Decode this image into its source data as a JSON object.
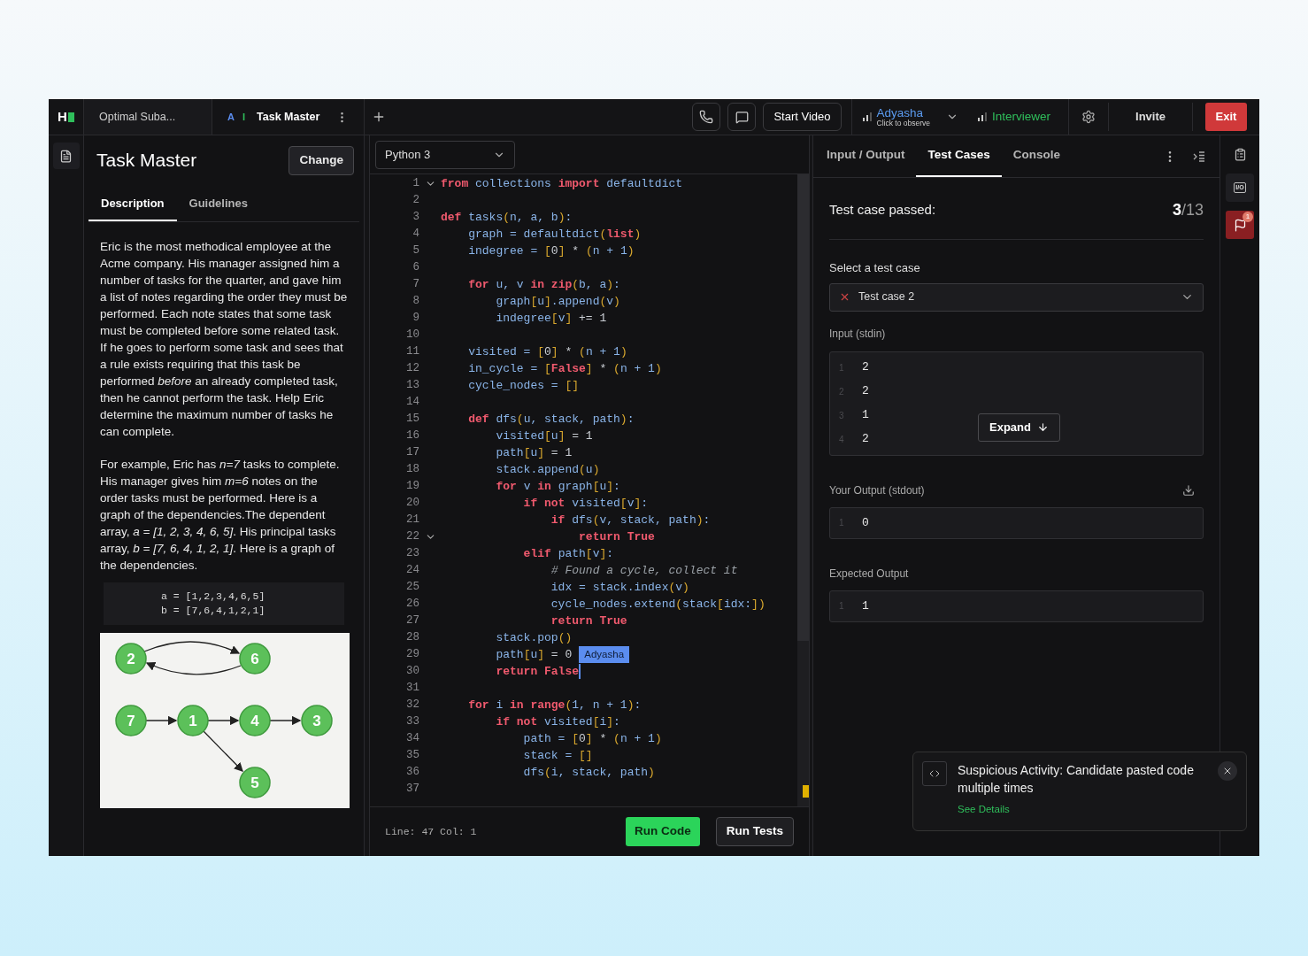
{
  "topbar": {
    "logo": "H",
    "tabs": [
      {
        "label": "Optimal Suba...",
        "selected": false
      },
      {
        "label": "Task Master",
        "selected": true,
        "markers": [
          {
            "text": "A",
            "color": "#5b8def"
          },
          {
            "text": "I",
            "color": "#2fbf5b"
          }
        ]
      }
    ],
    "start_video": "Start Video",
    "participants": [
      {
        "name": "Adyasha",
        "subtitle": "Click to observe",
        "color": "#5b9bf0",
        "menu": true
      },
      {
        "name": "Interviewer",
        "color": "#2fbf5b",
        "menu": false
      }
    ],
    "invite": "Invite",
    "exit": "Exit"
  },
  "problem": {
    "title": "Task Master",
    "change": "Change",
    "tabs": [
      {
        "label": "Description",
        "selected": true
      },
      {
        "label": "Guidelines",
        "selected": false
      }
    ],
    "paragraphs": [
      "Eric is the most methodical employee at the Acme company. His manager assigned him a number of tasks for the quarter, and gave him a list of notes regarding the order they must be performed. Each note states that some task must be completed before some related task. If he goes to perform some task and sees that a rule exists requiring that this task be performed *before* an already completed task, then he cannot perform the task. Help Eric determine the maximum number of tasks he can complete.",
      "For example, Eric has *n=7* tasks to complete. His manager gives him *m=6* notes on the order tasks must be performed. Here is a graph of the dependencies.The dependent array, *a = [1, 2, 3, 4, 6, 5]*. His principal tasks array, *b = [7, 6, 4, 1, 2, 1]*. Here is a graph of the dependencies."
    ],
    "code_sample": [
      "a = [1,2,3,4,6,5]",
      "b = [7,6,4,1,2,1]"
    ],
    "graph_nodes": [
      {
        "label": "2"
      },
      {
        "label": "6"
      },
      {
        "label": "7"
      },
      {
        "label": "1"
      },
      {
        "label": "4"
      },
      {
        "label": "3"
      },
      {
        "label": "5"
      }
    ]
  },
  "editor": {
    "language": "Python 3",
    "lines": [
      {
        "n": "1",
        "fold": true,
        "caret": false,
        "tokens": [
          {
            "kind": "kw",
            "text": "from"
          },
          {
            "kind": "name",
            "text": " collections "
          },
          {
            "kind": "kw",
            "text": "import"
          },
          {
            "kind": "name",
            "text": " defaultdict"
          }
        ]
      },
      {
        "n": "2",
        "fold": false,
        "caret": false
      },
      {
        "n": "3",
        "fold": false,
        "caret": false,
        "tokens": [
          {
            "kind": "kw",
            "text": "def"
          },
          {
            "kind": "name",
            "text": " tasks"
          },
          {
            "kind": "punct",
            "text": "("
          },
          {
            "kind": "name",
            "text": "n, a, b"
          },
          {
            "kind": "punct",
            "text": ")"
          },
          {
            "kind": "name",
            "text": ":"
          }
        ]
      },
      {
        "n": "4",
        "fold": false,
        "caret": false,
        "tokens": [
          {
            "kind": "name",
            "text": "    graph = defaultdict"
          },
          {
            "kind": "punct",
            "text": "("
          },
          {
            "kind": "kw",
            "text": "list"
          },
          {
            "kind": "punct",
            "text": ")"
          }
        ]
      },
      {
        "n": "5",
        "fold": false,
        "caret": false,
        "tokens": [
          {
            "kind": "name",
            "text": "    indegree = "
          },
          {
            "kind": "punct",
            "text": "["
          },
          {
            "kind": "op",
            "text": "0"
          },
          {
            "kind": "punct",
            "text": "]"
          },
          {
            "kind": "op",
            "text": " * "
          },
          {
            "kind": "punct",
            "text": "("
          },
          {
            "kind": "name",
            "text": "n + 1"
          },
          {
            "kind": "punct",
            "text": ")"
          }
        ]
      },
      {
        "n": "6",
        "fold": false,
        "caret": false
      },
      {
        "n": "7",
        "fold": false,
        "caret": false,
        "tokens": [
          {
            "kind": "kw",
            "text": "    for"
          },
          {
            "kind": "name",
            "text": " u, v "
          },
          {
            "kind": "kw",
            "text": "in zip"
          },
          {
            "kind": "punct",
            "text": "("
          },
          {
            "kind": "name",
            "text": "b, a"
          },
          {
            "kind": "punct",
            "text": ")"
          },
          {
            "kind": "name",
            "text": ":"
          }
        ]
      },
      {
        "n": "8",
        "fold": false,
        "caret": false,
        "tokens": [
          {
            "kind": "name",
            "text": "        graph"
          },
          {
            "kind": "punct",
            "text": "["
          },
          {
            "kind": "name",
            "text": "u"
          },
          {
            "kind": "punct",
            "text": "]"
          },
          {
            "kind": "name",
            "text": ".append"
          },
          {
            "kind": "punct",
            "text": "("
          },
          {
            "kind": "name",
            "text": "v"
          },
          {
            "kind": "punct",
            "text": ")"
          }
        ]
      },
      {
        "n": "9",
        "fold": false,
        "caret": false,
        "tokens": [
          {
            "kind": "name",
            "text": "        indegree"
          },
          {
            "kind": "punct",
            "text": "["
          },
          {
            "kind": "name",
            "text": "v"
          },
          {
            "kind": "punct",
            "text": "]"
          },
          {
            "kind": "op",
            "text": " += 1"
          }
        ]
      },
      {
        "n": "10",
        "fold": false,
        "caret": false
      },
      {
        "n": "11",
        "fold": false,
        "caret": false,
        "tokens": [
          {
            "kind": "name",
            "text": "    visited = "
          },
          {
            "kind": "punct",
            "text": "["
          },
          {
            "kind": "op",
            "text": "0"
          },
          {
            "kind": "punct",
            "text": "]"
          },
          {
            "kind": "op",
            "text": " * "
          },
          {
            "kind": "punct",
            "text": "("
          },
          {
            "kind": "name",
            "text": "n + 1"
          },
          {
            "kind": "punct",
            "text": ")"
          }
        ]
      },
      {
        "n": "12",
        "fold": false,
        "caret": false,
        "tokens": [
          {
            "kind": "name",
            "text": "    in_cycle = "
          },
          {
            "kind": "punct",
            "text": "["
          },
          {
            "kind": "kw",
            "text": "False"
          },
          {
            "kind": "punct",
            "text": "]"
          },
          {
            "kind": "op",
            "text": " * "
          },
          {
            "kind": "punct",
            "text": "("
          },
          {
            "kind": "name",
            "text": "n + 1"
          },
          {
            "kind": "punct",
            "text": ")"
          }
        ]
      },
      {
        "n": "13",
        "fold": false,
        "caret": false,
        "tokens": [
          {
            "kind": "name",
            "text": "    cycle_nodes = "
          },
          {
            "kind": "punct",
            "text": "[]"
          }
        ]
      },
      {
        "n": "14",
        "fold": false,
        "caret": false
      },
      {
        "n": "15",
        "fold": false,
        "caret": false,
        "tokens": [
          {
            "kind": "kw",
            "text": "    def"
          },
          {
            "kind": "name",
            "text": " dfs"
          },
          {
            "kind": "punct",
            "text": "("
          },
          {
            "kind": "name",
            "text": "u, stack, path"
          },
          {
            "kind": "punct",
            "text": ")"
          },
          {
            "kind": "name",
            "text": ":"
          }
        ]
      },
      {
        "n": "16",
        "fold": false,
        "caret": false,
        "tokens": [
          {
            "kind": "name",
            "text": "        visited"
          },
          {
            "kind": "punct",
            "text": "["
          },
          {
            "kind": "name",
            "text": "u"
          },
          {
            "kind": "punct",
            "text": "]"
          },
          {
            "kind": "op",
            "text": " = 1"
          }
        ]
      },
      {
        "n": "17",
        "fold": false,
        "caret": false,
        "tokens": [
          {
            "kind": "name",
            "text": "        path"
          },
          {
            "kind": "punct",
            "text": "["
          },
          {
            "kind": "name",
            "text": "u"
          },
          {
            "kind": "punct",
            "text": "]"
          },
          {
            "kind": "op",
            "text": " = 1"
          }
        ]
      },
      {
        "n": "18",
        "fold": false,
        "caret": false,
        "tokens": [
          {
            "kind": "name",
            "text": "        stack.append"
          },
          {
            "kind": "punct",
            "text": "("
          },
          {
            "kind": "name",
            "text": "u"
          },
          {
            "kind": "punct",
            "text": ")"
          }
        ]
      },
      {
        "n": "19",
        "fold": false,
        "caret": false,
        "tokens": [
          {
            "kind": "kw",
            "text": "        for"
          },
          {
            "kind": "name",
            "text": " v "
          },
          {
            "kind": "kw",
            "text": "in"
          },
          {
            "kind": "name",
            "text": " graph"
          },
          {
            "kind": "punct",
            "text": "["
          },
          {
            "kind": "name",
            "text": "u"
          },
          {
            "kind": "punct",
            "text": "]"
          },
          {
            "kind": "name",
            "text": ":"
          }
        ]
      },
      {
        "n": "20",
        "fold": false,
        "caret": false,
        "tokens": [
          {
            "kind": "kw",
            "text": "            if not"
          },
          {
            "kind": "name",
            "text": " visited"
          },
          {
            "kind": "punct",
            "text": "["
          },
          {
            "kind": "name",
            "text": "v"
          },
          {
            "kind": "punct",
            "text": "]"
          },
          {
            "kind": "name",
            "text": ":"
          }
        ]
      },
      {
        "n": "21",
        "fold": false,
        "caret": false,
        "tokens": [
          {
            "kind": "kw",
            "text": "                if"
          },
          {
            "kind": "name",
            "text": " dfs"
          },
          {
            "kind": "punct",
            "text": "("
          },
          {
            "kind": "name",
            "text": "v, stack, path"
          },
          {
            "kind": "punct",
            "text": ")"
          },
          {
            "kind": "name",
            "text": ":"
          }
        ]
      },
      {
        "n": "22",
        "fold": true,
        "caret": false,
        "tokens": [
          {
            "kind": "kw",
            "text": "                    return True"
          }
        ]
      },
      {
        "n": "23",
        "fold": false,
        "caret": false,
        "tokens": [
          {
            "kind": "kw",
            "text": "            elif"
          },
          {
            "kind": "name",
            "text": " path"
          },
          {
            "kind": "punct",
            "text": "["
          },
          {
            "kind": "name",
            "text": "v"
          },
          {
            "kind": "punct",
            "text": "]"
          },
          {
            "kind": "name",
            "text": ":"
          }
        ]
      },
      {
        "n": "24",
        "fold": false,
        "caret": false,
        "tokens": [
          {
            "kind": "comment",
            "text": "                # Found a cycle, collect it"
          }
        ]
      },
      {
        "n": "25",
        "fold": false,
        "caret": false,
        "tokens": [
          {
            "kind": "name",
            "text": "                idx = stack.index"
          },
          {
            "kind": "punct",
            "text": "("
          },
          {
            "kind": "name",
            "text": "v"
          },
          {
            "kind": "punct",
            "text": ")"
          }
        ]
      },
      {
        "n": "26",
        "fold": false,
        "caret": false,
        "tokens": [
          {
            "kind": "name",
            "text": "                cycle_nodes.extend"
          },
          {
            "kind": "punct",
            "text": "("
          },
          {
            "kind": "name",
            "text": "stack"
          },
          {
            "kind": "punct",
            "text": "["
          },
          {
            "kind": "name",
            "text": "idx:"
          },
          {
            "kind": "punct",
            "text": "])"
          }
        ]
      },
      {
        "n": "27",
        "fold": false,
        "caret": false,
        "tokens": [
          {
            "kind": "kw",
            "text": "                return True"
          }
        ]
      },
      {
        "n": "28",
        "fold": false,
        "caret": false,
        "tokens": [
          {
            "kind": "name",
            "text": "        stack.pop"
          },
          {
            "kind": "punct",
            "text": "()"
          }
        ]
      },
      {
        "n": "29",
        "fold": false,
        "caret": false,
        "tokens": [
          {
            "kind": "name",
            "text": "        path"
          },
          {
            "kind": "punct",
            "text": "["
          },
          {
            "kind": "name",
            "text": "u"
          },
          {
            "kind": "punct",
            "text": "]"
          },
          {
            "kind": "op",
            "text": " = 0"
          }
        ],
        "collaborator": "Adyasha"
      },
      {
        "n": "30",
        "fold": false,
        "caret": true,
        "tokens": [
          {
            "kind": "kw",
            "text": "        return False"
          }
        ]
      },
      {
        "n": "31",
        "fold": false,
        "caret": false
      },
      {
        "n": "32",
        "fold": false,
        "caret": false,
        "tokens": [
          {
            "kind": "kw",
            "text": "    for"
          },
          {
            "kind": "name",
            "text": " i "
          },
          {
            "kind": "kw",
            "text": "in range"
          },
          {
            "kind": "punct",
            "text": "("
          },
          {
            "kind": "name",
            "text": "1, n + 1"
          },
          {
            "kind": "punct",
            "text": ")"
          },
          {
            "kind": "name",
            "text": ":"
          }
        ]
      },
      {
        "n": "33",
        "fold": false,
        "caret": false,
        "tokens": [
          {
            "kind": "kw",
            "text": "        if not"
          },
          {
            "kind": "name",
            "text": " visited"
          },
          {
            "kind": "punct",
            "text": "["
          },
          {
            "kind": "name",
            "text": "i"
          },
          {
            "kind": "punct",
            "text": "]"
          },
          {
            "kind": "name",
            "text": ":"
          }
        ]
      },
      {
        "n": "34",
        "fold": false,
        "caret": false,
        "tokens": [
          {
            "kind": "name",
            "text": "            path = "
          },
          {
            "kind": "punct",
            "text": "["
          },
          {
            "kind": "op",
            "text": "0"
          },
          {
            "kind": "punct",
            "text": "]"
          },
          {
            "kind": "op",
            "text": " * "
          },
          {
            "kind": "punct",
            "text": "("
          },
          {
            "kind": "name",
            "text": "n + 1"
          },
          {
            "kind": "punct",
            "text": ")"
          }
        ]
      },
      {
        "n": "35",
        "fold": false,
        "caret": false,
        "tokens": [
          {
            "kind": "name",
            "text": "            stack = "
          },
          {
            "kind": "punct",
            "text": "[]"
          }
        ]
      },
      {
        "n": "36",
        "fold": false,
        "caret": false,
        "tokens": [
          {
            "kind": "name",
            "text": "            dfs"
          },
          {
            "kind": "punct",
            "text": "("
          },
          {
            "kind": "name",
            "text": "i, stack, path"
          },
          {
            "kind": "punct",
            "text": ")"
          }
        ]
      },
      {
        "n": "37",
        "fold": false,
        "caret": false
      }
    ],
    "status": "Line: 47 Col: 1",
    "run_code": "Run Code",
    "run_tests": "Run Tests"
  },
  "results": {
    "tabs": [
      {
        "label": "Input / Output",
        "selected": false
      },
      {
        "label": "Test Cases",
        "selected": true
      },
      {
        "label": "Console",
        "selected": false
      }
    ],
    "passed_label": "Test case passed:",
    "passed": "3",
    "total": "/13",
    "select_label": "Select a test case",
    "selected_case": {
      "label": "Test case 2",
      "passed": false
    },
    "input_label": "Input (stdin)",
    "input": [
      {
        "n": "1",
        "v": "2"
      },
      {
        "n": "2",
        "v": "2"
      },
      {
        "n": "3",
        "v": "1"
      },
      {
        "n": "4",
        "v": "2"
      }
    ],
    "expand": "Expand",
    "output_label": "Your Output (stdout)",
    "output": [
      {
        "n": "1",
        "v": "0"
      }
    ],
    "expected_label": "Expected Output",
    "expected": [
      {
        "n": "1",
        "v": "1"
      }
    ]
  },
  "rail": {
    "io": "I/O",
    "flag_count": "1"
  },
  "toast": {
    "message": "Suspicious Activity: Candidate pasted code multiple times",
    "link": "See Details"
  }
}
